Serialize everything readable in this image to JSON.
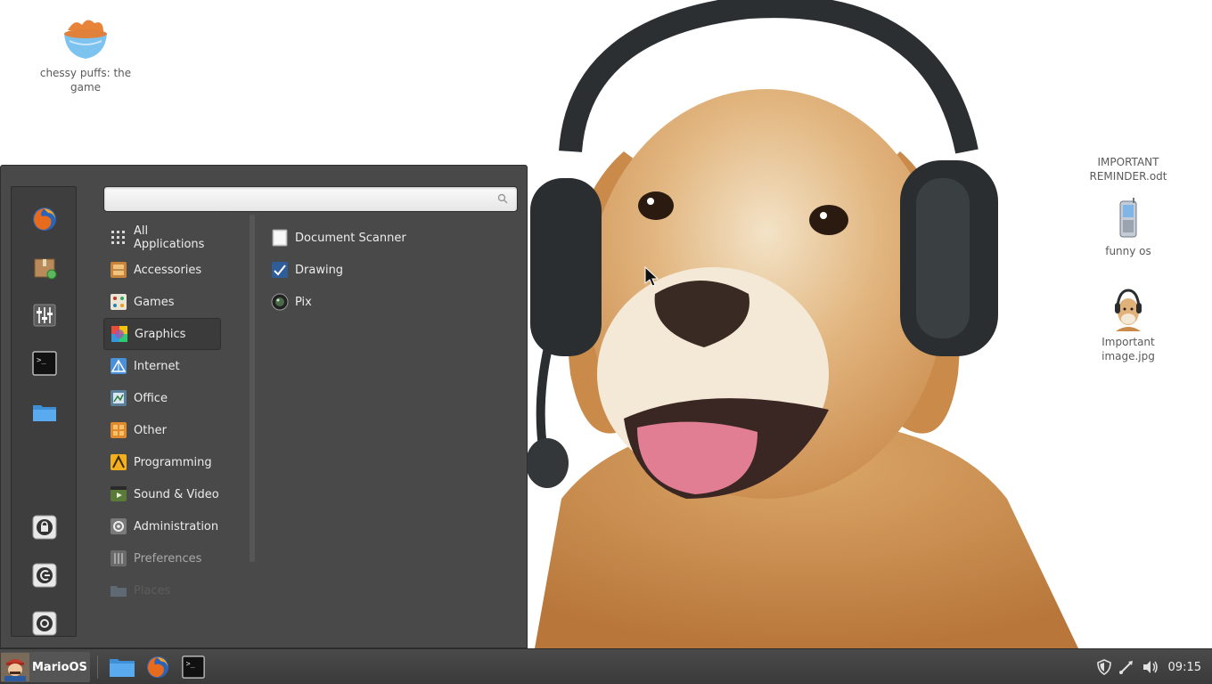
{
  "colors": {
    "menu_bg": "#494949",
    "favorites_bg": "#3e3e3e",
    "taskbar_bg": "#3e3e3e",
    "menu_text": "#ececec",
    "wallpaper_dog": "#d9a464"
  },
  "desktop": {
    "icons": [
      {
        "label": "chessy puffs: the game",
        "icon": "cheese-puffs-bowl-icon"
      },
      {
        "label": "IMPORTANT REMINDER.odt",
        "icon": "document-icon"
      },
      {
        "label": "funny os",
        "icon": "mobile-phone-icon"
      },
      {
        "label": "Important image.jpg",
        "icon": "dog-image-thumbnail-icon"
      }
    ]
  },
  "menu": {
    "search": {
      "value": "",
      "placeholder": ""
    },
    "favorites": [
      {
        "icon": "firefox-icon"
      },
      {
        "icon": "software-package-icon"
      },
      {
        "icon": "settings-sliders-icon"
      },
      {
        "icon": "terminal-icon"
      },
      {
        "icon": "folder-icon"
      }
    ],
    "session_buttons": [
      {
        "icon": "lock-screen-icon"
      },
      {
        "icon": "logout-icon"
      },
      {
        "icon": "power-icon"
      }
    ],
    "categories": [
      {
        "label": "All Applications",
        "icon": "grid-icon"
      },
      {
        "label": "Accessories",
        "icon": "accessories-icon"
      },
      {
        "label": "Games",
        "icon": "games-icon"
      },
      {
        "label": "Graphics",
        "icon": "graphics-icon",
        "selected": true
      },
      {
        "label": "Internet",
        "icon": "internet-icon"
      },
      {
        "label": "Office",
        "icon": "office-icon"
      },
      {
        "label": "Other",
        "icon": "other-icon"
      },
      {
        "label": "Programming",
        "icon": "programming-icon"
      },
      {
        "label": "Sound & Video",
        "icon": "sound-video-icon"
      },
      {
        "label": "Administration",
        "icon": "administration-icon"
      },
      {
        "label": "Preferences",
        "icon": "preferences-icon"
      },
      {
        "label": "Places",
        "icon": "places-folder-icon"
      }
    ],
    "apps": [
      {
        "label": "Document Scanner",
        "icon": "scanner-icon"
      },
      {
        "label": "Drawing",
        "icon": "drawing-icon"
      },
      {
        "label": "Pix",
        "icon": "pix-icon"
      }
    ]
  },
  "taskbar": {
    "start_label": "MarioOS",
    "launchers": [
      {
        "icon": "folder-icon"
      },
      {
        "icon": "firefox-icon"
      },
      {
        "icon": "terminal-icon"
      }
    ],
    "tray": [
      {
        "icon": "shield-icon"
      },
      {
        "icon": "network-icon"
      },
      {
        "icon": "volume-icon"
      }
    ],
    "clock": "09:15"
  }
}
